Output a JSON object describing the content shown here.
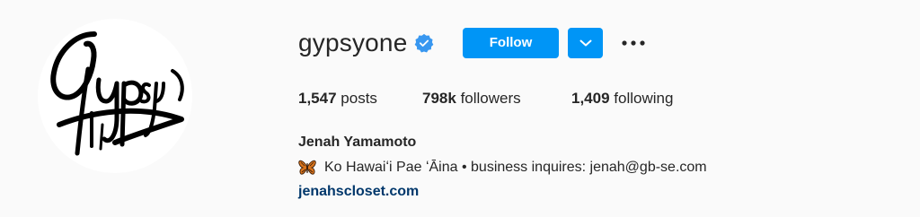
{
  "profile": {
    "username": "gypsyone",
    "verified_icon": "verified-badge-icon",
    "follow_label": "Follow",
    "dropdown_icon": "chevron-down-icon",
    "more_icon": "more-options-icon",
    "stats": {
      "posts_count": "1,547",
      "posts_label": "posts",
      "followers_count": "798k",
      "followers_label": "followers",
      "following_count": "1,409",
      "following_label": "following"
    },
    "full_name": "Jenah Yamamoto",
    "bio_emoji_icon": "butterfly-icon",
    "bio_text": "Ko Hawaiʻi Pae ʻĀina • business inquires: jenah@gb-se.com",
    "website": "jenahscloset.com",
    "colors": {
      "accent": "#0095f6",
      "link": "#00376b",
      "background": "#fafafa",
      "text": "#262626"
    }
  }
}
